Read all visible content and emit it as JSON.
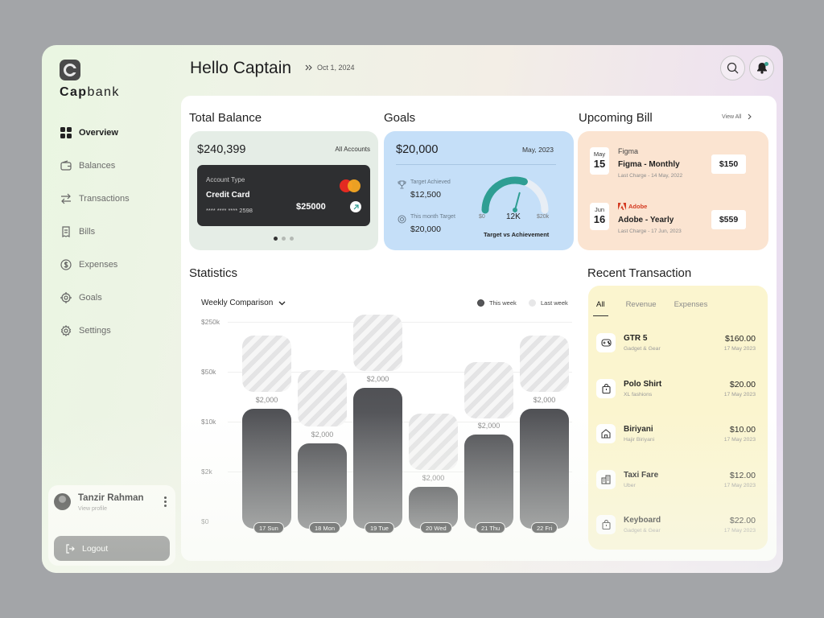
{
  "brand": {
    "name_bold": "Cap",
    "name_rest": "bank"
  },
  "sidebar": {
    "items": [
      {
        "label": "Overview",
        "icon": "grid-icon",
        "active": true
      },
      {
        "label": "Balances",
        "icon": "wallet-icon"
      },
      {
        "label": "Transactions",
        "icon": "transfer-icon"
      },
      {
        "label": "Bills",
        "icon": "receipt-icon"
      },
      {
        "label": "Expenses",
        "icon": "dollar-icon"
      },
      {
        "label": "Goals",
        "icon": "target-icon"
      },
      {
        "label": "Settings",
        "icon": "gear-icon"
      }
    ],
    "profile": {
      "name": "Tanzir Rahman",
      "sub": "View profile"
    },
    "logout": "Logout"
  },
  "header": {
    "greeting": "Hello Captain",
    "date": "Oct 1, 2024"
  },
  "balance": {
    "title": "Total Balance",
    "amount": "$240,399",
    "link": "All Accounts",
    "card": {
      "type_label": "Account Type",
      "type": "Credit Card",
      "number": "**** **** **** 2598",
      "amount": "$25000"
    },
    "pages": 3,
    "active_page": 0
  },
  "goals": {
    "title": "Goals",
    "amount": "$20,000",
    "month": "May, 2023",
    "achieved_label": "Target Achieved",
    "achieved_value": "$12,500",
    "month_target_label": "This month Target",
    "month_target_value": "$20,000",
    "gauge": {
      "min_label": "$0",
      "max_label": "$20k",
      "current_label": "12K",
      "fraction": 0.6
    },
    "caption": "Target vs Achievement",
    "accent": "#2e9e93"
  },
  "bills": {
    "title": "Upcoming Bill",
    "view_all": "View All",
    "items": [
      {
        "month": "May",
        "day": "15",
        "brand": "Figma",
        "name": "Figma - Monthly",
        "sub": "Last Charge - 14 May, 2022",
        "amount": "$150"
      },
      {
        "month": "Jun",
        "day": "16",
        "brand": "Adobe",
        "name": "Adobe - Yearly",
        "sub": "Last Charge - 17 Jun, 2023",
        "amount": "$559"
      }
    ]
  },
  "statistics": {
    "title": "Statistics",
    "dropdown": "Weekly Comparison",
    "legend": [
      "This week",
      "Last week"
    ],
    "legend_colors": [
      "#555659",
      "#e7e7e8"
    ]
  },
  "chart_data": {
    "type": "bar",
    "categories": [
      "17 Sun",
      "18 Mon",
      "19 Tue",
      "20 Wed",
      "21 Thu",
      "22 Fri"
    ],
    "y_ticks": [
      "$250k",
      "$50k",
      "$10k",
      "$2k",
      "$0"
    ],
    "series": [
      {
        "name": "This week",
        "values": [
          0.69,
          0.49,
          0.81,
          0.24,
          0.54,
          0.69
        ]
      },
      {
        "name": "Last week",
        "values": [
          1.11,
          0.91,
          1.23,
          0.66,
          0.96,
          1.11
        ]
      }
    ],
    "data_labels": [
      "$2,000",
      "$2,000",
      "$2,000",
      "$2,000",
      "$2,000",
      "$2,000"
    ],
    "ylim": [
      0,
      1.25
    ]
  },
  "transactions": {
    "title": "Recent Transaction",
    "tabs": [
      "All",
      "Revenue",
      "Expenses"
    ],
    "items": [
      {
        "name": "GTR 5",
        "sub": "Gadget & Gear",
        "amount": "$160.00",
        "date": "17 May 2023",
        "icon": "gamepad-icon"
      },
      {
        "name": "Polo Shirt",
        "sub": "XL fashions",
        "amount": "$20.00",
        "date": "17 May 2023",
        "icon": "bag-icon"
      },
      {
        "name": "Biriyani",
        "sub": "Hajir Biriyani",
        "amount": "$10.00",
        "date": "17 May 2023",
        "icon": "store-icon"
      },
      {
        "name": "Taxi Fare",
        "sub": "Uber",
        "amount": "$12.00",
        "date": "17 May 2023",
        "icon": "building-icon"
      },
      {
        "name": "Keyboard",
        "sub": "Gadget & Gear",
        "amount": "$22.00",
        "date": "17 May 2023",
        "icon": "bag-icon"
      }
    ]
  }
}
